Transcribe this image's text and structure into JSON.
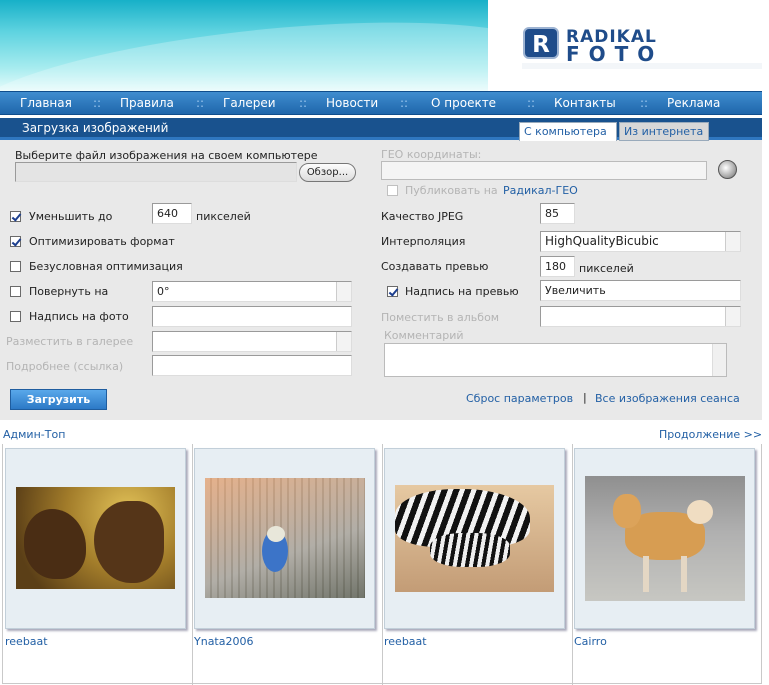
{
  "brand": {
    "logo_text_line1": "RADIKAL",
    "logo_text_line2": "FOTO",
    "logo_letter": "R"
  },
  "nav": {
    "items": [
      "Главная",
      "Правила",
      "Галереи",
      "Новости",
      "О проекте",
      "Контакты",
      "Реклама"
    ],
    "separator": "::"
  },
  "panel": {
    "title": "Загрузка изображений",
    "tabs": [
      "С компьютера",
      "Из интернета"
    ]
  },
  "left": {
    "file_label": "Выберите файл изображения на своем компьютере",
    "browse_label": "Обзор...",
    "reduce_label": "Уменьшить до",
    "reduce_value": "640",
    "reduce_unit": "пикселей",
    "optimize_label": "Оптимизировать формат",
    "force_optimize_label": "Безусловная оптимизация",
    "rotate_label": "Повернуть на",
    "rotate_value": "0°",
    "caption_label": "Надпись на фото",
    "caption_value": "",
    "gallery_label": "Разместить в галерее",
    "details_label": "Подробнее (ссылка)",
    "upload_button": "Загрузить"
  },
  "right": {
    "geo_label": "ГЕО координаты:",
    "publish_label": "Публиковать на",
    "publish_link": "Радикал-ГЕО",
    "jpeg_label": "Качество JPEG",
    "jpeg_value": "85",
    "interp_label": "Интерполяция",
    "interp_value": "HighQualityBicubic",
    "preview_label": "Создавать превью",
    "preview_value": "180",
    "preview_unit": "пикселей",
    "preview_caption_label": "Надпись на превью",
    "preview_caption_value": "Увеличить",
    "album_label": "Поместить в альбом",
    "comment_label": "Комментарий",
    "reset_link": "Сброс параметров",
    "link_sep": "|",
    "session_link": "Все изображения сеанса"
  },
  "gallery": {
    "title": "Админ-Топ",
    "more": "Продолжение >>",
    "captions": [
      "reebaat",
      "Ynata2006",
      "reebaat",
      "Cairro"
    ]
  },
  "colors": {
    "accent": "#2360a5",
    "nav": "#2a74bb",
    "title_bar": "#19528e",
    "panel_bg": "#e9e9e9"
  }
}
